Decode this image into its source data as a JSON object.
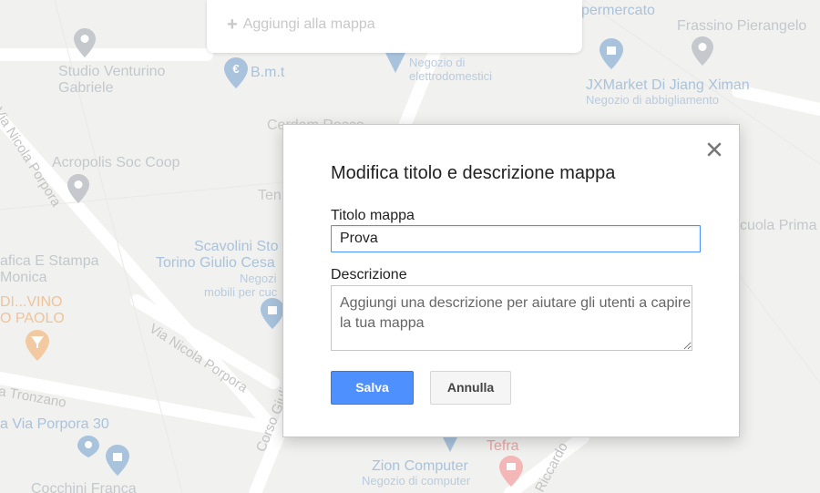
{
  "top_panel": {
    "add_to_map": "Aggiungi alla mappa"
  },
  "map": {
    "pois": [
      {
        "name": "Studio Venturino",
        "name2": "Gabriele"
      },
      {
        "name": "B.m.t"
      },
      {
        "name": "Negozio di",
        "name2": "elettrodomestici"
      },
      {
        "name": "permercato"
      },
      {
        "name": "Frassino Pierangelo"
      },
      {
        "name": "JXMarket Di Jiang Ximan",
        "sub": "Negozio di abbigliamento"
      },
      {
        "name": "Acropolis Soc Coop"
      },
      {
        "name": "Scavolini Sto",
        "name2": "Torino Giulio Cesa",
        "sub": "Negozi",
        "sub2": "mobili per cuc"
      },
      {
        "name": "afica E Stampa",
        "name2": "Monica"
      },
      {
        "name": "DI...VINO",
        "name2": "O PAOLO"
      },
      {
        "name": "cuola Prima"
      },
      {
        "name": "Zion Computer",
        "sub": "Negozio di computer"
      },
      {
        "name": "Tefra"
      },
      {
        "name": "a Via Porpora 30"
      },
      {
        "name": "Cocchini Franca"
      },
      {
        "name": "Cerdam Rocco"
      },
      {
        "name": "Ten"
      }
    ],
    "streets": [
      "Via Nicola Porpora",
      "Via Nicola Porpora",
      "a Tronzano",
      "Corso Giulio",
      "Riccardo"
    ]
  },
  "dialog": {
    "title": "Modifica titolo e descrizione mappa",
    "title_label": "Titolo mappa",
    "title_value": "Prova",
    "desc_label": "Descrizione",
    "desc_placeholder": "Aggiungi una descrizione per aiutare gli utenti a capire la tua mappa",
    "save_label": "Salva",
    "cancel_label": "Annulla"
  },
  "colors": {
    "primary_button": "#4d90fe",
    "input_focus_border": "#4d90fe",
    "map_background": "#f1f1ef"
  }
}
